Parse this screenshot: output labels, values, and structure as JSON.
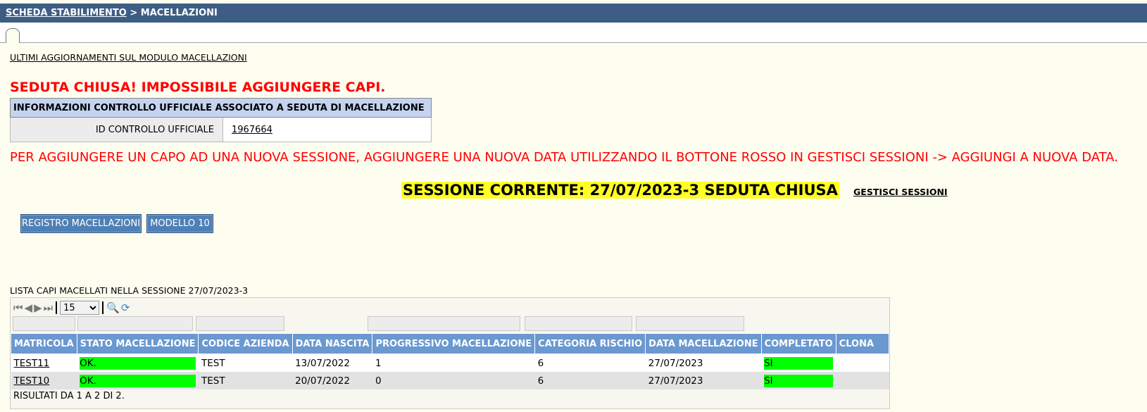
{
  "breadcrumb": {
    "link": "SCHEDA STABILIMENTO",
    "current": " > MACELLAZIONI"
  },
  "updates_link": "ULTIMI AGGIORNAMENTI SUL MODULO MACELLAZIONI",
  "closed_message": "SEDUTA CHIUSA! IMPOSSIBILE AGGIUNGERE CAPI.",
  "info": {
    "header": "INFORMAZIONI CONTROLLO UFFICIALE ASSOCIATO A SEDUTA DI MACELLAZIONE",
    "label": "ID CONTROLLO UFFICIALE",
    "value": "1967664"
  },
  "add_message": "PER AGGIUNGERE UN CAPO AD UNA NUOVA SESSIONE, AGGIUNGERE UNA NUOVA DATA UTILIZZANDO IL BOTTONE ROSSO IN GESTISCI SESSIONI -> AGGIUNGI A NUOVA DATA.",
  "session": {
    "current": "SESSIONE CORRENTE: 27/07/2023-3 SEDUTA CHIUSA",
    "manage_link": "GESTISCI SESSIONI"
  },
  "buttons": {
    "registro": "REGISTRO MACELLAZIONI",
    "modello": "MODELLO 10"
  },
  "list_title": "LISTA CAPI MACELLATI NELLA SESSIONE 27/07/2023-3",
  "pager": {
    "page_size": "15"
  },
  "table": {
    "headers": [
      "MATRICOLA",
      "STATO MACELLAZIONE",
      "CODICE AZIENDA",
      "DATA NASCITA",
      "PROGRESSIVO MACELLAZIONE",
      "CATEGORIA RISCHIO",
      "DATA MACELLAZIONE",
      "COMPLETATO",
      "CLONA"
    ],
    "rows": [
      [
        "TEST11",
        "OK.",
        "TEST",
        "13/07/2022",
        "1",
        "6",
        "27/07/2023",
        "SI",
        ""
      ],
      [
        "TEST10",
        "OK.",
        "TEST",
        "20/07/2022",
        "0",
        "6",
        "27/07/2023",
        "SI",
        ""
      ]
    ]
  },
  "results_text": "RISULTATI DA 1 A 2 DI 2.",
  "colors": {
    "topbar": "#3d5d84",
    "header": "#6a98d0",
    "ok": "#00ff00",
    "alert": "#ff0000",
    "highlight": "#ffff22"
  }
}
